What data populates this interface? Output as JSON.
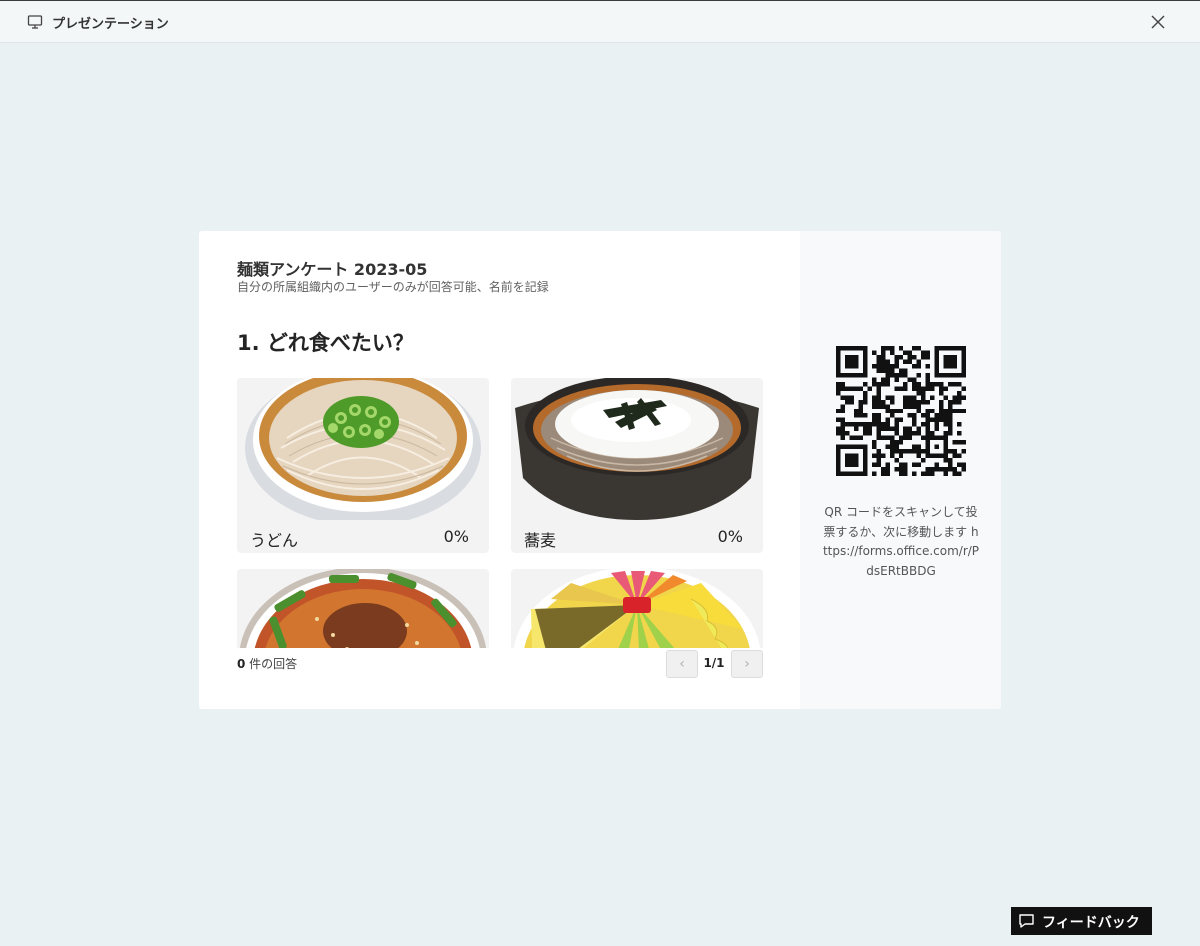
{
  "window": {
    "title": "プレゼンテーション",
    "icon": "monitor-icon",
    "close_icon": "close-icon"
  },
  "form": {
    "title": "麺類アンケート 2023-05",
    "subtitle": "自分の所属組織内のユーザーのみが回答可能、名前を記録",
    "question": "1. どれ食べたい？",
    "options": [
      {
        "label": "うどん",
        "percent": "0%",
        "image": "udon-bowl-image"
      },
      {
        "label": "蕎麦",
        "percent": "0%",
        "image": "soba-bowl-image"
      },
      {
        "label": "",
        "percent": "",
        "image": "tantanmen-bowl-image"
      },
      {
        "label": "",
        "percent": "",
        "image": "hiyashi-chuka-image"
      }
    ],
    "responses_count": "0",
    "responses_suffix": " 件の回答",
    "pager": {
      "prev": "‹",
      "current": "1/1",
      "next": "›"
    }
  },
  "share": {
    "qr_icon": "qr-code-icon",
    "text": "QR コードをスキャンして投票するか、次に移動します https://forms.office.com/r/PdsERtBBDG"
  },
  "feedback": {
    "label": "フィードバック",
    "icon": "feedback-icon"
  }
}
